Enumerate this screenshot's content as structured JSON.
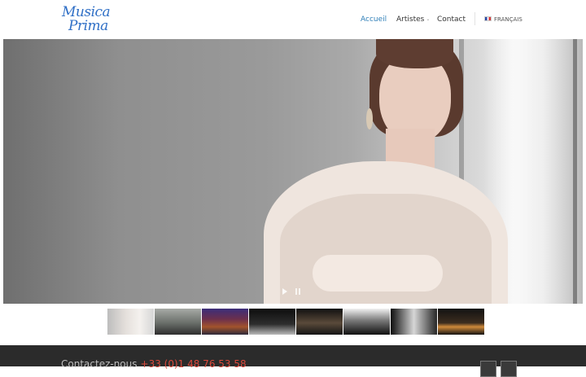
{
  "header": {
    "logo": {
      "line1": "Musica",
      "line2": "Prima"
    },
    "nav": [
      {
        "label": "Accueil",
        "active": true
      },
      {
        "label": "Artistes",
        "has_submenu": true
      },
      {
        "label": "Contact"
      }
    ],
    "language": {
      "label": "FRANÇAIS",
      "flag": "flag-france-icon"
    }
  },
  "slideshow": {
    "controls": {
      "play": "play-icon",
      "pause": "pause-icon"
    },
    "thumbnail_count": 8,
    "active_thumbnail": 1
  },
  "footer": {
    "contact_label": "Contactez-nous",
    "phone": "+33 (0)1 48 76 53 58"
  },
  "colors": {
    "accent_blue": "#2f7fb8",
    "logo_blue": "#2f6fc6",
    "phone_red": "#d9483b",
    "footer_bg": "#2b2b2b"
  }
}
